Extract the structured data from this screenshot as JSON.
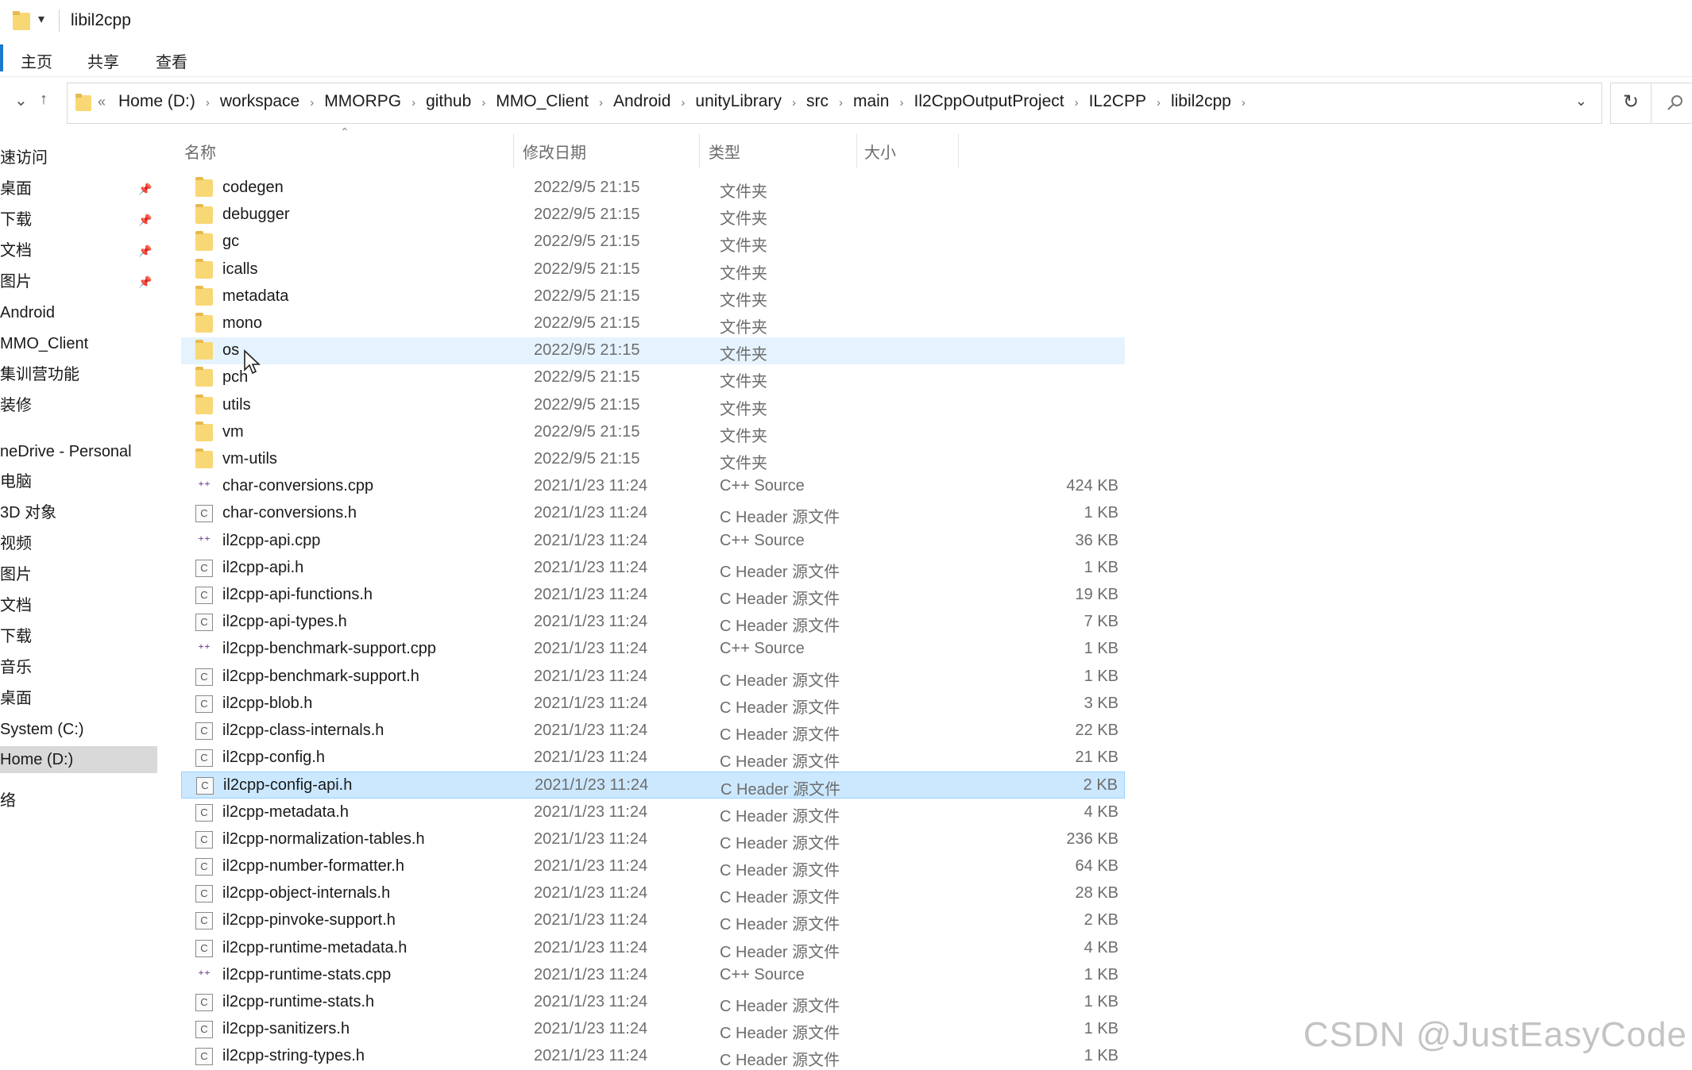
{
  "window": {
    "title": "libil2cpp",
    "quick_access_arrow": "▾"
  },
  "ribbon": {
    "tabs": [
      "主页",
      "共享",
      "查看"
    ]
  },
  "address": {
    "lead": "«",
    "crumbs": [
      "Home (D:)",
      "workspace",
      "MMORPG",
      "github",
      "MMO_Client",
      "Android",
      "unityLibrary",
      "src",
      "main",
      "Il2CppOutputProject",
      "IL2CPP",
      "libil2cpp"
    ],
    "first_crumb_leading": "Home (D:)"
  },
  "nav": {
    "items": [
      {
        "label": "速访问",
        "pinned": false
      },
      {
        "label": "桌面",
        "pinned": true
      },
      {
        "label": "下载",
        "pinned": true
      },
      {
        "label": "文档",
        "pinned": true
      },
      {
        "label": "图片",
        "pinned": true
      },
      {
        "label": "Android",
        "pinned": false
      },
      {
        "label": "MMO_Client",
        "pinned": false
      },
      {
        "label": "集训营功能",
        "pinned": false
      },
      {
        "label": "装修",
        "pinned": false
      },
      {
        "label": "neDrive - Personal",
        "pinned": false
      },
      {
        "label": "电脑",
        "pinned": false
      },
      {
        "label": "3D 对象",
        "pinned": false
      },
      {
        "label": "视频",
        "pinned": false
      },
      {
        "label": "图片",
        "pinned": false
      },
      {
        "label": "文档",
        "pinned": false
      },
      {
        "label": "下载",
        "pinned": false
      },
      {
        "label": "音乐",
        "pinned": false
      },
      {
        "label": "桌面",
        "pinned": false
      },
      {
        "label": "System (C:)",
        "pinned": false
      },
      {
        "label": "Home (D:)",
        "pinned": false,
        "selected": true
      },
      {
        "label": "络",
        "pinned": false
      }
    ]
  },
  "columns": {
    "name": "名称",
    "date": "修改日期",
    "type": "类型",
    "size": "大小"
  },
  "files": [
    {
      "name": "codegen",
      "date": "2022/9/5 21:15",
      "type": "文件夹",
      "size": "",
      "icon": "folder-icon"
    },
    {
      "name": "debugger",
      "date": "2022/9/5 21:15",
      "type": "文件夹",
      "size": "",
      "icon": "folder-icon"
    },
    {
      "name": "gc",
      "date": "2022/9/5 21:15",
      "type": "文件夹",
      "size": "",
      "icon": "folder-icon"
    },
    {
      "name": "icalls",
      "date": "2022/9/5 21:15",
      "type": "文件夹",
      "size": "",
      "icon": "folder-icon"
    },
    {
      "name": "metadata",
      "date": "2022/9/5 21:15",
      "type": "文件夹",
      "size": "",
      "icon": "folder-icon"
    },
    {
      "name": "mono",
      "date": "2022/9/5 21:15",
      "type": "文件夹",
      "size": "",
      "icon": "folder-icon"
    },
    {
      "name": "os",
      "date": "2022/9/5 21:15",
      "type": "文件夹",
      "size": "",
      "icon": "folder-icon",
      "state": "hover"
    },
    {
      "name": "pch",
      "date": "2022/9/5 21:15",
      "type": "文件夹",
      "size": "",
      "icon": "folder-icon"
    },
    {
      "name": "utils",
      "date": "2022/9/5 21:15",
      "type": "文件夹",
      "size": "",
      "icon": "folder-icon"
    },
    {
      "name": "vm",
      "date": "2022/9/5 21:15",
      "type": "文件夹",
      "size": "",
      "icon": "folder-icon"
    },
    {
      "name": "vm-utils",
      "date": "2022/9/5 21:15",
      "type": "文件夹",
      "size": "",
      "icon": "folder-icon"
    },
    {
      "name": "char-conversions.cpp",
      "date": "2021/1/23 11:24",
      "type": "C++ Source",
      "size": "424 KB",
      "icon": "cpp-file-icon"
    },
    {
      "name": "char-conversions.h",
      "date": "2021/1/23 11:24",
      "type": "C Header 源文件",
      "size": "1 KB",
      "icon": "header-file-icon"
    },
    {
      "name": "il2cpp-api.cpp",
      "date": "2021/1/23 11:24",
      "type": "C++ Source",
      "size": "36 KB",
      "icon": "cpp-file-icon"
    },
    {
      "name": "il2cpp-api.h",
      "date": "2021/1/23 11:24",
      "type": "C Header 源文件",
      "size": "1 KB",
      "icon": "header-file-icon"
    },
    {
      "name": "il2cpp-api-functions.h",
      "date": "2021/1/23 11:24",
      "type": "C Header 源文件",
      "size": "19 KB",
      "icon": "header-file-icon"
    },
    {
      "name": "il2cpp-api-types.h",
      "date": "2021/1/23 11:24",
      "type": "C Header 源文件",
      "size": "7 KB",
      "icon": "header-file-icon"
    },
    {
      "name": "il2cpp-benchmark-support.cpp",
      "date": "2021/1/23 11:24",
      "type": "C++ Source",
      "size": "1 KB",
      "icon": "cpp-file-icon"
    },
    {
      "name": "il2cpp-benchmark-support.h",
      "date": "2021/1/23 11:24",
      "type": "C Header 源文件",
      "size": "1 KB",
      "icon": "header-file-icon"
    },
    {
      "name": "il2cpp-blob.h",
      "date": "2021/1/23 11:24",
      "type": "C Header 源文件",
      "size": "3 KB",
      "icon": "header-file-icon"
    },
    {
      "name": "il2cpp-class-internals.h",
      "date": "2021/1/23 11:24",
      "type": "C Header 源文件",
      "size": "22 KB",
      "icon": "header-file-icon"
    },
    {
      "name": "il2cpp-config.h",
      "date": "2021/1/23 11:24",
      "type": "C Header 源文件",
      "size": "21 KB",
      "icon": "header-file-icon"
    },
    {
      "name": "il2cpp-config-api.h",
      "date": "2021/1/23 11:24",
      "type": "C Header 源文件",
      "size": "2 KB",
      "icon": "header-file-icon",
      "state": "selected"
    },
    {
      "name": "il2cpp-metadata.h",
      "date": "2021/1/23 11:24",
      "type": "C Header 源文件",
      "size": "4 KB",
      "icon": "header-file-icon"
    },
    {
      "name": "il2cpp-normalization-tables.h",
      "date": "2021/1/23 11:24",
      "type": "C Header 源文件",
      "size": "236 KB",
      "icon": "header-file-icon"
    },
    {
      "name": "il2cpp-number-formatter.h",
      "date": "2021/1/23 11:24",
      "type": "C Header 源文件",
      "size": "64 KB",
      "icon": "header-file-icon"
    },
    {
      "name": "il2cpp-object-internals.h",
      "date": "2021/1/23 11:24",
      "type": "C Header 源文件",
      "size": "28 KB",
      "icon": "header-file-icon"
    },
    {
      "name": "il2cpp-pinvoke-support.h",
      "date": "2021/1/23 11:24",
      "type": "C Header 源文件",
      "size": "2 KB",
      "icon": "header-file-icon"
    },
    {
      "name": "il2cpp-runtime-metadata.h",
      "date": "2021/1/23 11:24",
      "type": "C Header 源文件",
      "size": "4 KB",
      "icon": "header-file-icon"
    },
    {
      "name": "il2cpp-runtime-stats.cpp",
      "date": "2021/1/23 11:24",
      "type": "C++ Source",
      "size": "1 KB",
      "icon": "cpp-file-icon"
    },
    {
      "name": "il2cpp-runtime-stats.h",
      "date": "2021/1/23 11:24",
      "type": "C Header 源文件",
      "size": "1 KB",
      "icon": "header-file-icon"
    },
    {
      "name": "il2cpp-sanitizers.h",
      "date": "2021/1/23 11:24",
      "type": "C Header 源文件",
      "size": "1 KB",
      "icon": "header-file-icon"
    },
    {
      "name": "il2cpp-string-types.h",
      "date": "2021/1/23 11:24",
      "type": "C Header 源文件",
      "size": "1 KB",
      "icon": "header-file-icon"
    }
  ],
  "colors": {
    "hover_row": "#e5f3ff",
    "selected_row": "#cce8ff",
    "folder": "#f8d775",
    "accent": "#1979ca"
  },
  "watermark": "CSDN @JustEasyCode"
}
